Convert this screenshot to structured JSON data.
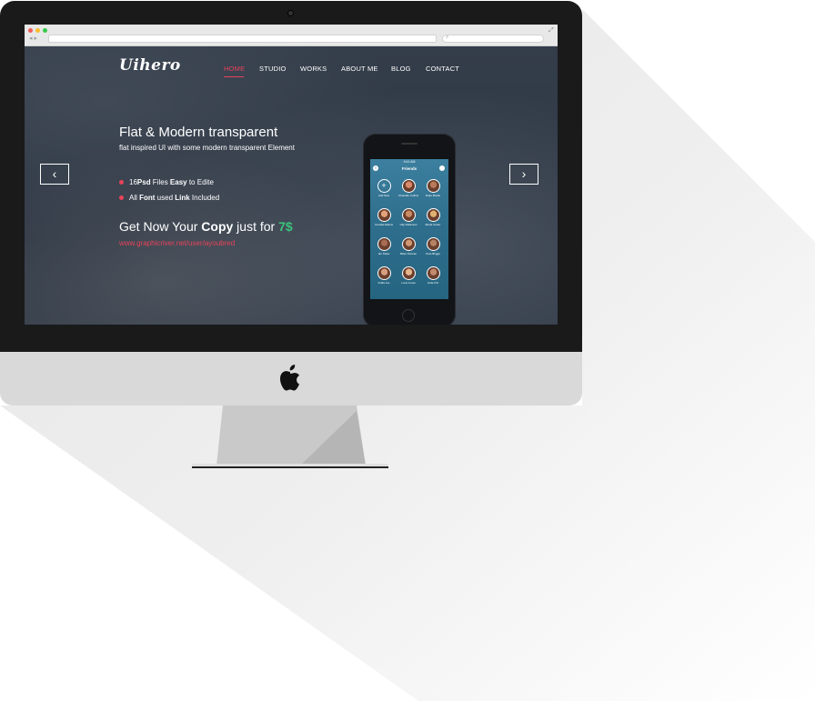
{
  "browser": {
    "address": "",
    "nav_back": "◂ ▸",
    "expand": "⤢"
  },
  "site": {
    "logo": "Uihero",
    "nav": [
      "HOME",
      "STUDIO",
      "WORKS",
      "ABOUT ME",
      "BLOG",
      "CONTACT"
    ],
    "active_nav": "HOME",
    "prev_arrow": "‹",
    "next_arrow": "›",
    "headline": "Flat & Modern transparent",
    "subheadline": "flat inspired UI with some modern transparent Element",
    "bullets": [
      {
        "pre": "16",
        "bold": "Psd",
        "mid": " Files ",
        "bold2": "Easy",
        "post": " to Edite"
      },
      {
        "pre": "All ",
        "bold": "Font",
        "mid": " used ",
        "bold2": "Link",
        "post": " Included"
      }
    ],
    "cta": {
      "pre": "Get Now Your ",
      "bold": "Copy",
      "mid": " just for ",
      "price": "7$"
    },
    "link": "www.graphicriver.net/user/ayoubred"
  },
  "phone": {
    "status": "9:41 AM",
    "title": "Friends",
    "friends": [
      {
        "name": "Add New",
        "color": "transparent"
      },
      {
        "name": "Chandler Collins",
        "color": "#d98a6a"
      },
      {
        "name": "Duke Bustle",
        "color": "#b97a5a"
      },
      {
        "name": "Cecelia Adams",
        "color": "#e3a27a"
      },
      {
        "name": "Lilly Patterson",
        "color": "#c98b64"
      },
      {
        "name": "Maria Carter",
        "color": "#e0b070"
      },
      {
        "name": "Ian Shaw",
        "color": "#a86c52"
      },
      {
        "name": "Miles Duncan",
        "color": "#cf9772"
      },
      {
        "name": "Pete Briggs",
        "color": "#b58263"
      },
      {
        "name": "Indiia Joe",
        "color": "#d79f80"
      },
      {
        "name": "Luna Jones",
        "color": "#e6b48a"
      },
      {
        "name": "Jude Fitz",
        "color": "#c48a6e"
      }
    ]
  },
  "colors": {
    "accent": "#e8435b",
    "price": "#3cc47c",
    "bezel": "#1a1a1b",
    "chin": "#d9d9da"
  }
}
